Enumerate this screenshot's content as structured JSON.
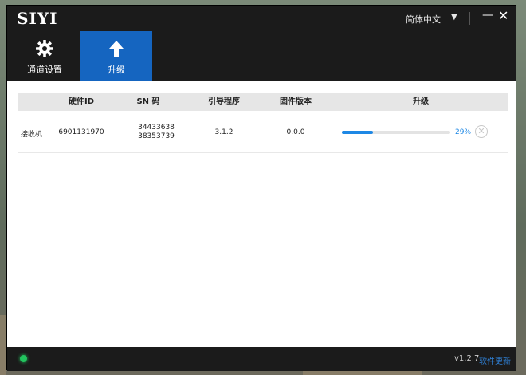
{
  "app": {
    "logo": "SIYI",
    "language": "简体中文",
    "colors": {
      "accent": "#1565c0",
      "progress": "#1e88e5",
      "status_ok": "#22c55e"
    }
  },
  "tabs": [
    {
      "label": "通道设置",
      "icon": "gear-icon",
      "active": false
    },
    {
      "label": "升级",
      "icon": "arrow-up-icon",
      "active": true
    }
  ],
  "table": {
    "headers": [
      "硬件ID",
      "SN 码",
      "引导程序",
      "固件版本",
      "升级"
    ],
    "rows": [
      {
        "name": "接收机",
        "hardware_id": "6901131970",
        "sn_line1": "34433638",
        "sn_line2": "38353739",
        "bootloader": "3.1.2",
        "firmware": "0.0.0",
        "progress_pct": 29,
        "progress_text": "29%"
      }
    ]
  },
  "status": {
    "version": "v1.2.7",
    "update_link": "软件更新"
  }
}
